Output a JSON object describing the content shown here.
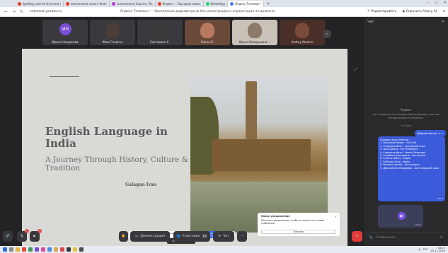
{
  "browser": {
    "tabs": [
      {
        "label": "Spelling cant be this hard |",
        "color": "#e8382c"
      },
      {
        "label": "luminescent cavern find t",
        "color": "#e8382c"
      },
      {
        "label": "Luminescent Cavern | Pix",
        "color": "#c43bd1"
      },
      {
        "label": "Яндекс — Быстрый поиск",
        "color": "#f23a1e"
      },
      {
        "label": "WhatsApp",
        "color": "#25d366"
      },
      {
        "label": "Яндекс Телемост",
        "color": "#4a7cf0"
      }
    ],
    "url": "telemost.yandex.ru",
    "page_title": "Яндекс Телемост — бесплатные видеовстречи без регистрации и ограничения по времени",
    "edit_label": "Редактировать",
    "alice_label": "Спросить Алису AI"
  },
  "participants": [
    {
      "name": "Ирина Некрасова",
      "initials": "ИН",
      "avatar_color": "#7b4fd6"
    },
    {
      "name": "Иван Галаган",
      "initials": "",
      "avatar_color": "#5a4a40"
    },
    {
      "name": "Екатерина С.",
      "initials": "",
      "avatar_color": "#3f6b4a"
    },
    {
      "name": "Елена Я.",
      "initials": "",
      "avatar_color": "#8a4a38"
    },
    {
      "name": "Ирина Валерьевна ...",
      "initials": "",
      "avatar_color": "#b8a08a"
    },
    {
      "name": "Andrey Moutrin",
      "initials": "",
      "avatar_color": "#5a3a2a"
    }
  ],
  "slide": {
    "title": "English Language in India",
    "subtitle": "A Journey Through History, Culture & Tradition",
    "author": "Galagan Ivan"
  },
  "share_bar": {
    "text": "Приложение telemost.yandex.ru предоставляет доступ к вашему экрану.",
    "stop_label": "Закрыть доступ",
    "hide_label": "Скрыть"
  },
  "notification": {
    "title": "Новое уведомление",
    "body": "Включите уведомления, чтобы не пропустить новые сообщения.",
    "button": "Понятно"
  },
  "speaker_label": "Иван Галаган",
  "toolbar": {
    "demo_label": "Демонстрация",
    "participants_label": "Участники",
    "participants_count": "12",
    "chat_label": "Чат",
    "more_label": "···"
  },
  "chat": {
    "header": "Чат",
    "yandex_label": "Яндекс",
    "info_text": "Чат сохраняется в Яндекс Мессенджере, если вы авторизованы на Яндексе.",
    "today_label": "Сегодня",
    "greeting": "Добрый вечер",
    "greeting_time": "18:21",
    "list_lines": [
      "Порядок выступления :",
      "1. Николаев Мирон - the USA",
      "2. Сподеров Иван - канадский язык",
      "3. Зыза Диана - the Philippines",
      "4. Комарков Иван - Новая Зеландия",
      "5. Скрибина Екатерина - Австралия",
      "6. Галаган Иван - Индия",
      "7. Бобкова Элла - Wales",
      "8. Рипенко Артём - Шотландия",
      "9. Демьяненко Владимир - Шотландский язык"
    ],
    "list_time": "18:22",
    "video_time": "18:21",
    "input_placeholder": "Сообщение..."
  },
  "taskbar": {
    "lang": "РУС",
    "time": "18:27",
    "date": "15.11.2025"
  }
}
